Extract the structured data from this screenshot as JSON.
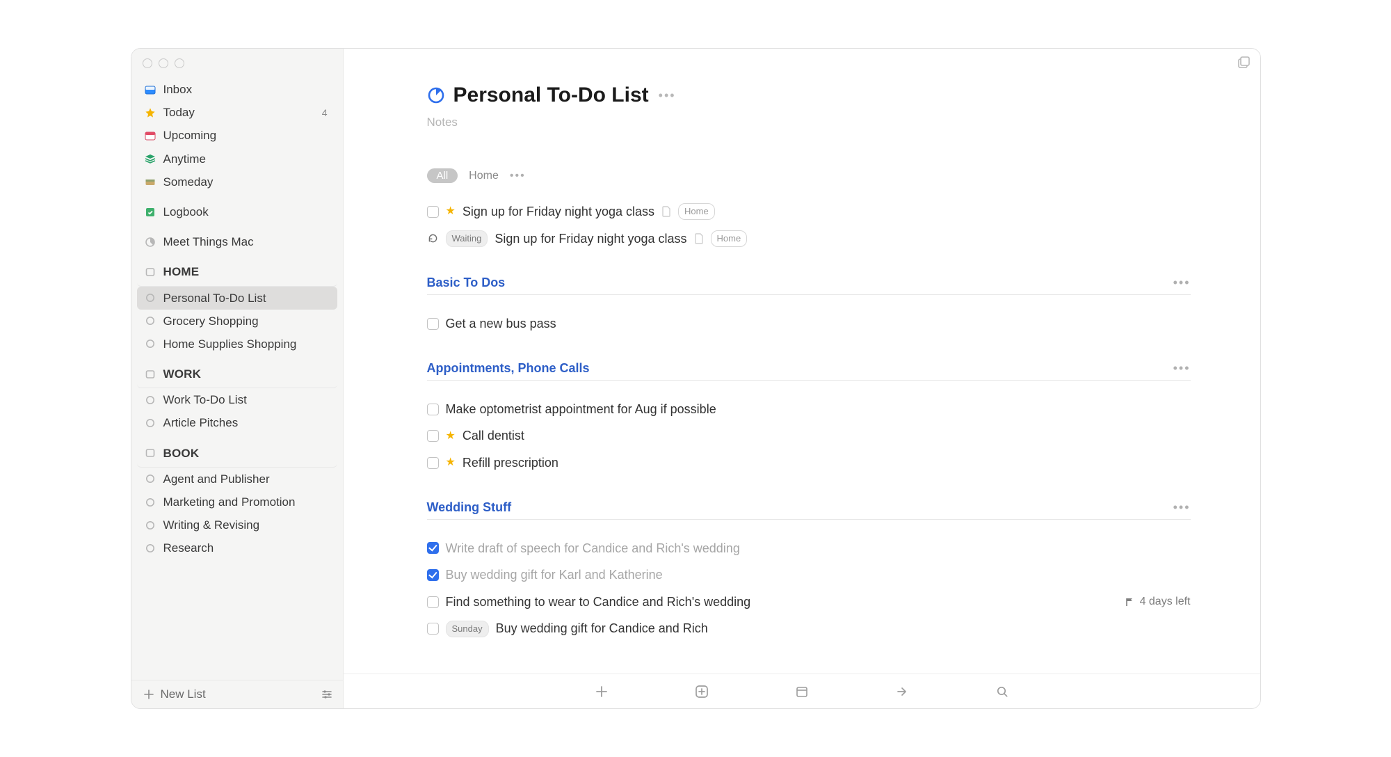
{
  "window": {
    "expand_icon_title": "New window"
  },
  "sidebar": {
    "smart": [
      {
        "icon": "inbox",
        "label": "Inbox",
        "count": ""
      },
      {
        "icon": "star",
        "label": "Today",
        "count": "4"
      },
      {
        "icon": "calendar",
        "label": "Upcoming",
        "count": ""
      },
      {
        "icon": "stack",
        "label": "Anytime",
        "count": ""
      },
      {
        "icon": "drawer",
        "label": "Someday",
        "count": ""
      }
    ],
    "logbook": {
      "label": "Logbook"
    },
    "meet": {
      "label": "Meet Things Mac"
    },
    "areas": [
      {
        "name": "HOME",
        "projects": [
          {
            "label": "Personal To-Do List",
            "selected": true
          },
          {
            "label": "Grocery Shopping"
          },
          {
            "label": "Home Supplies Shopping"
          }
        ]
      },
      {
        "name": "WORK",
        "projects": [
          {
            "label": "Work To-Do List"
          },
          {
            "label": "Article Pitches"
          }
        ]
      },
      {
        "name": "BOOK",
        "projects": [
          {
            "label": "Agent and Publisher"
          },
          {
            "label": "Marketing and Promotion"
          },
          {
            "label": "Writing & Revising"
          },
          {
            "label": "Research"
          }
        ]
      }
    ],
    "new_list_label": "New List"
  },
  "main": {
    "title": "Personal To-Do List",
    "notes_placeholder": "Notes",
    "filters": {
      "all": "All",
      "tag": "Home"
    },
    "unsection_tasks": [
      {
        "checked": false,
        "star": true,
        "badge": "",
        "title": "Sign up for Friday night yoga class",
        "note": true,
        "tag": "Home",
        "repeat": false
      },
      {
        "checked": false,
        "star": false,
        "badge": "Waiting",
        "title": "Sign up for Friday night yoga class",
        "note": true,
        "tag": "Home",
        "repeat": true
      }
    ],
    "sections": [
      {
        "name": "Basic To Dos",
        "tasks": [
          {
            "checked": false,
            "title": "Get a new bus pass"
          }
        ]
      },
      {
        "name": "Appointments, Phone Calls",
        "tasks": [
          {
            "checked": false,
            "title": "Make optometrist appointment for Aug if possible"
          },
          {
            "checked": false,
            "star": true,
            "title": "Call dentist"
          },
          {
            "checked": false,
            "star": true,
            "title": "Refill prescription"
          }
        ]
      },
      {
        "name": "Wedding Stuff",
        "tasks": [
          {
            "checked": true,
            "title": "Write draft of speech for Candice and Rich's wedding"
          },
          {
            "checked": true,
            "title": "Buy wedding gift for Karl and Katherine"
          },
          {
            "checked": false,
            "title": "Find something to wear to Candice and Rich's wedding",
            "due": "4 days left"
          },
          {
            "checked": false,
            "badge": "Sunday",
            "title": "Buy wedding gift for Candice and Rich"
          }
        ]
      }
    ]
  }
}
